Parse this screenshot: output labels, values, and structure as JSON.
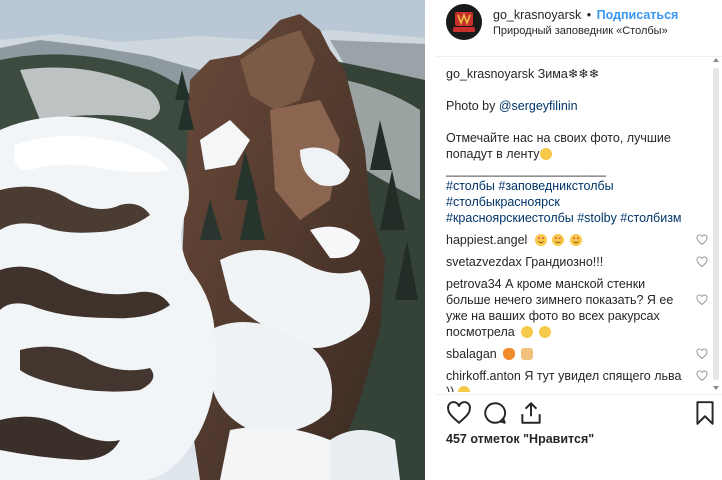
{
  "post": {
    "photo_description_icon": "photo",
    "header": {
      "username": "go_krasnoyarsk",
      "separator": "•",
      "follow_label": "Подписаться",
      "location": "Природный заповедник «Столбы»"
    },
    "caption": {
      "username": "go_krasnoyarsk",
      "title": "Зима❄❄❄",
      "photo_by_prefix": "Photo by ",
      "photo_by_user": "@sergeyfilinin",
      "line1": "Отмечайте нас на своих фото, лучшие",
      "line2": "попадут в ленту",
      "rule": "_______________________",
      "hashtags_line1": "#столбы #заповедникстолбы",
      "hashtags_line2": "#столбыкрасноярск",
      "hashtags_line3": "#красноярскиестолбы #stolby #столбизм"
    },
    "comments": [
      {
        "user": "happiest.angel",
        "text": "",
        "emoji": [
          "heart-eyes",
          "heart-eyes",
          "heart-eyes"
        ]
      },
      {
        "user": "svetazvezdax",
        "text": "Грандиозно!!!",
        "emoji": []
      },
      {
        "user": "petrova34",
        "text": "А кроме манской стенки больше нечего зимнего показать? Я ее уже на ваших фото во всех ракурсах посмотрела",
        "emoji": [
          "wink",
          "smile-eyes"
        ]
      },
      {
        "user": "sbalagan",
        "text": "",
        "emoji": [
          "fire",
          "hands"
        ]
      },
      {
        "user": "chirkoff.anton",
        "text": "Я тут увидел спящего льва ))",
        "emoji": [
          "smile"
        ]
      }
    ],
    "likes_label": "457 отметок \"Нравится\"",
    "icons": {
      "like": "heart-icon",
      "comment": "comment-bubble-icon",
      "share": "share-icon",
      "save": "bookmark-icon"
    }
  }
}
